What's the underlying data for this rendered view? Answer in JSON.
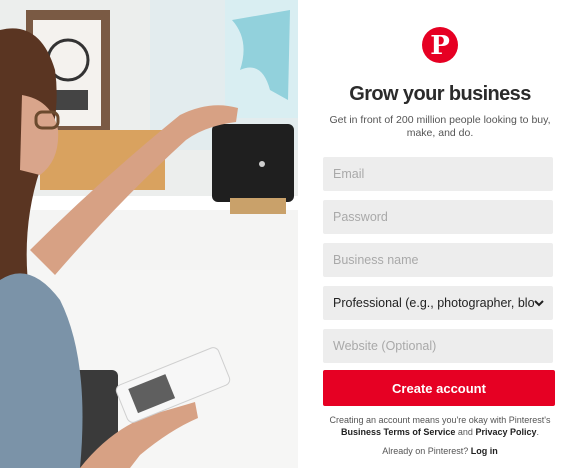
{
  "colors": {
    "brand": "#e60023",
    "field_bg": "#ededed",
    "text": "#2b2b2b"
  },
  "logo": {
    "glyph": "P",
    "icon": "pinterest-logo"
  },
  "headline": "Grow your business",
  "subheadline": "Get in front of 200 million people looking to buy, make, and do.",
  "form": {
    "email_placeholder": "Email",
    "password_placeholder": "Password",
    "business_name_placeholder": "Business name",
    "business_type_selected": "Professional (e.g., photographer, blo",
    "website_placeholder": "Website (Optional)",
    "submit_label": "Create account"
  },
  "terms": {
    "prefix": "Creating an account means you're okay with Pinterest's",
    "tos_link": "Business Terms of Service",
    "and": "and",
    "privacy_link": "Privacy Policy",
    "suffix": "."
  },
  "login": {
    "prompt": "Already on Pinterest?",
    "link": "Log in"
  },
  "hero": {
    "desc_icon": "woman-with-phone-photo"
  }
}
